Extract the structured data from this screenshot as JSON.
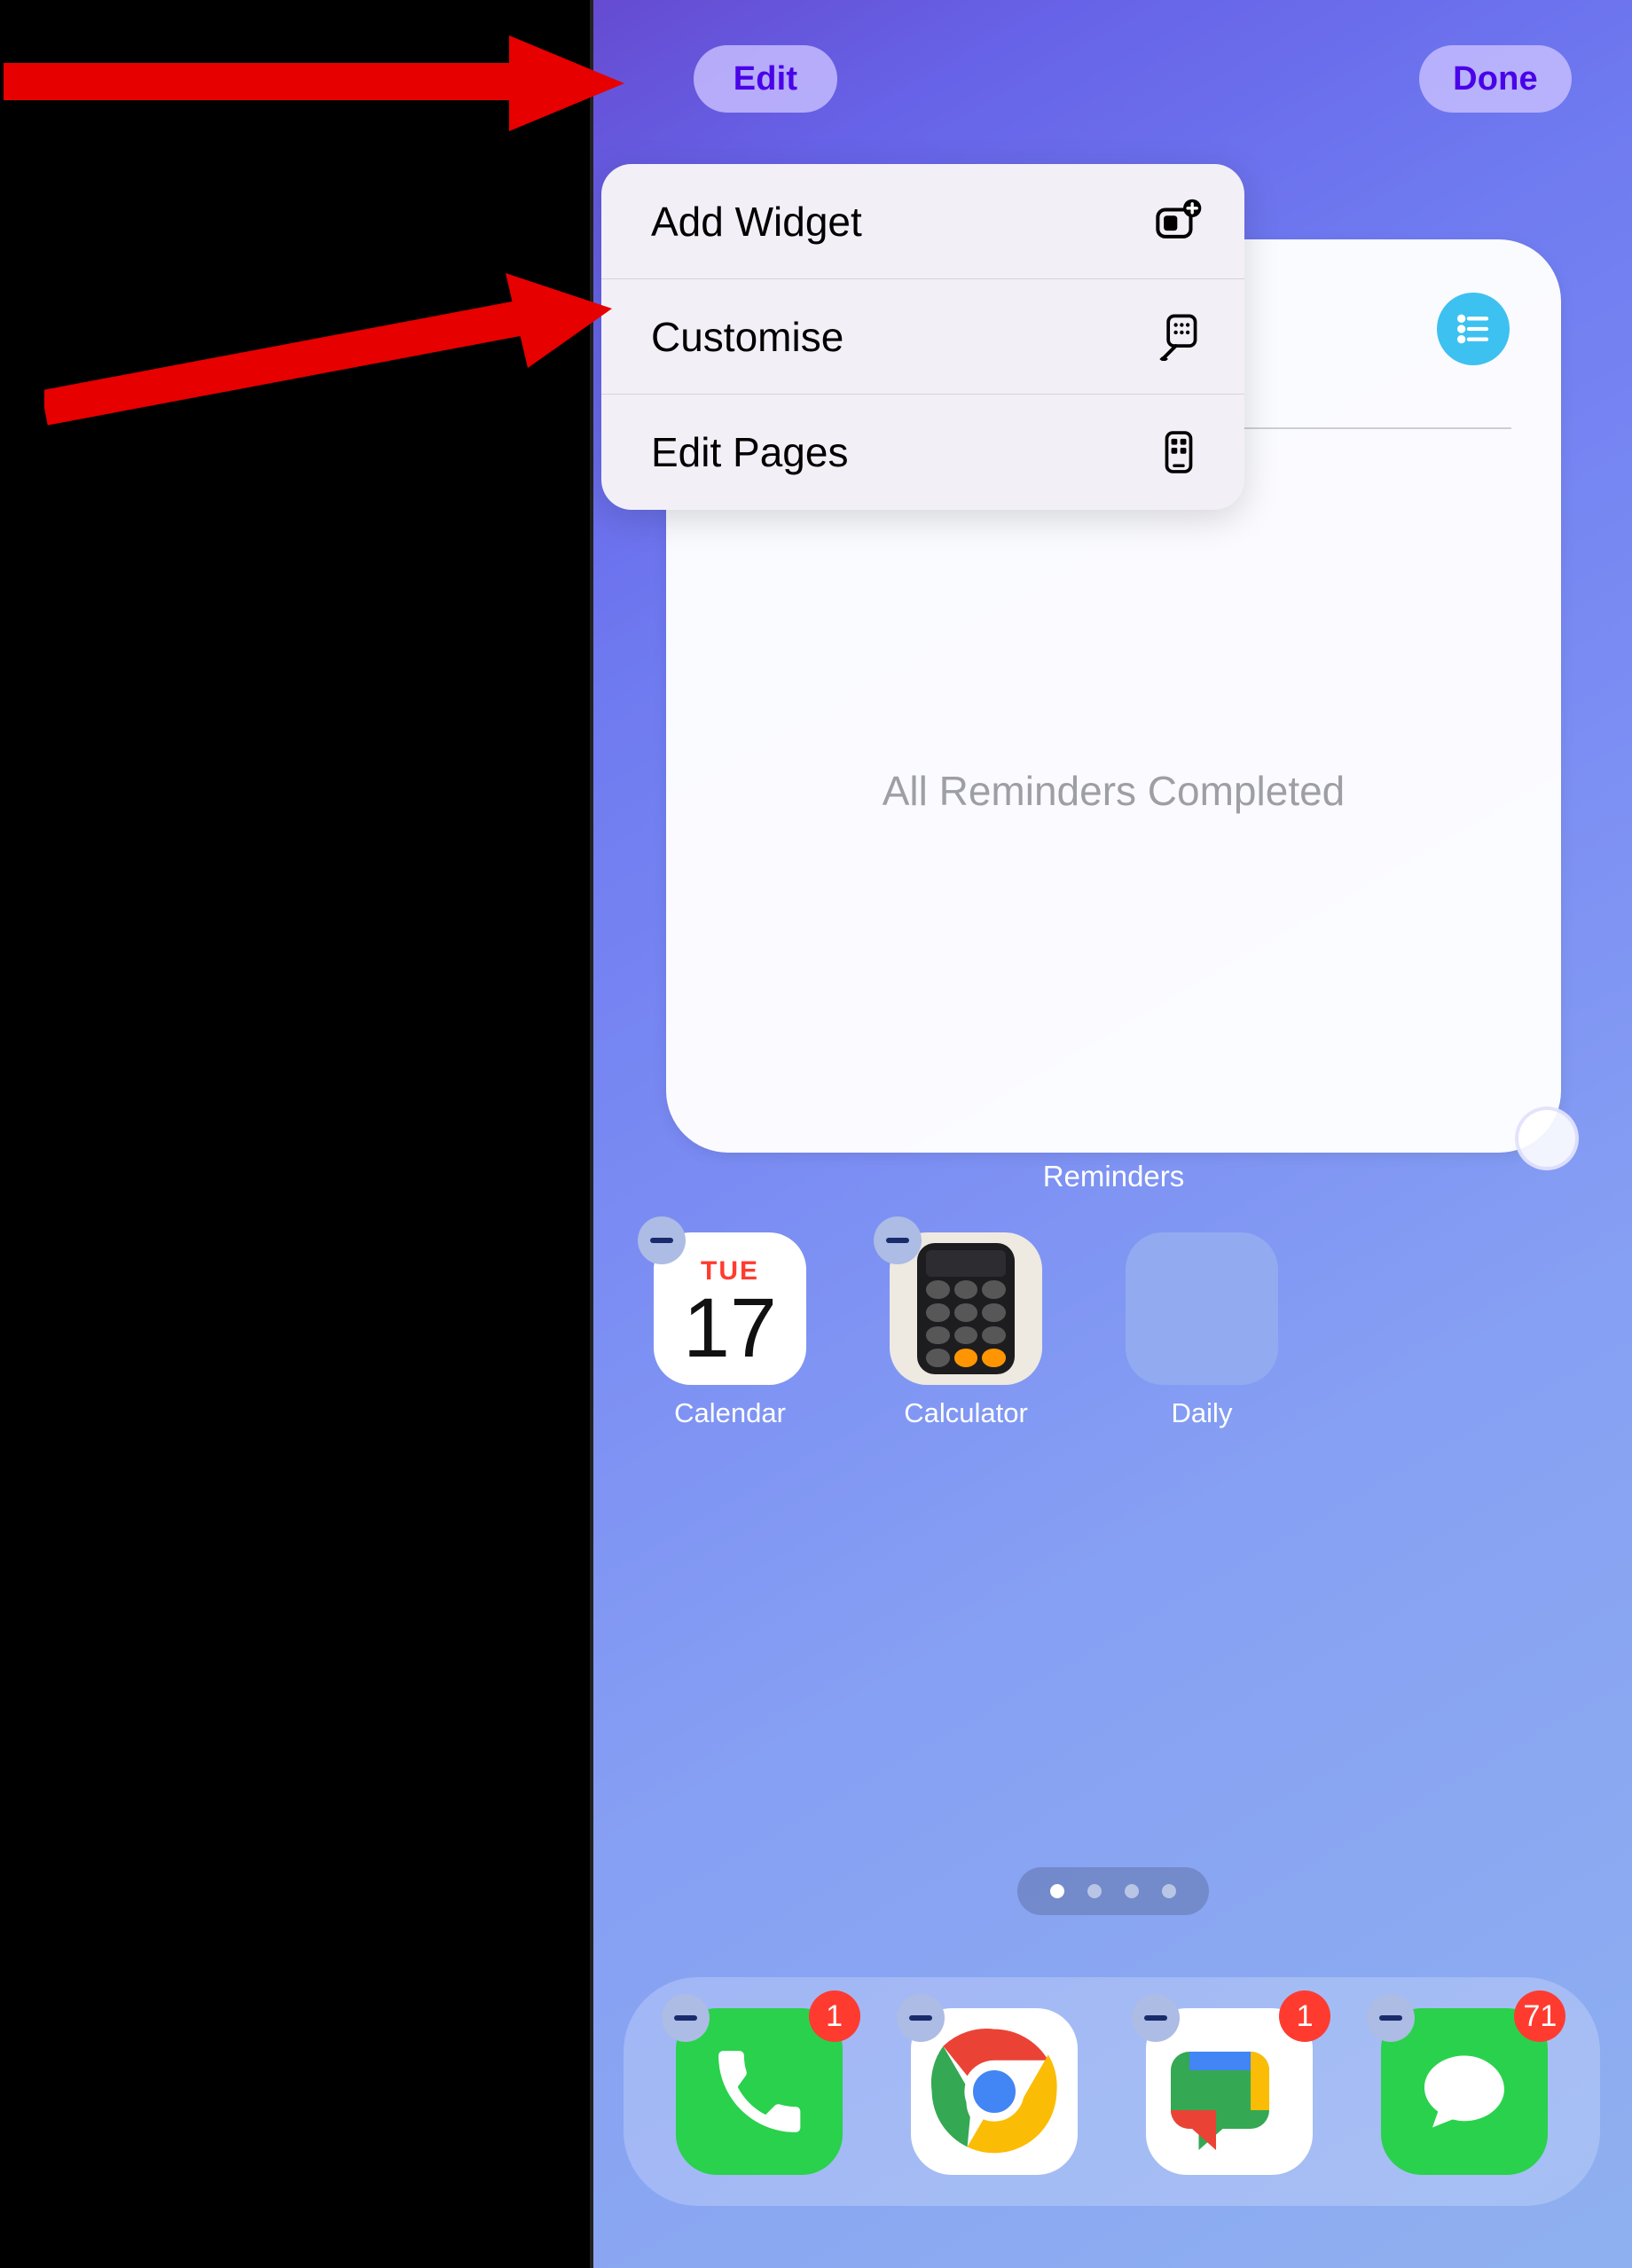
{
  "top_bar": {
    "edit_label": "Edit",
    "done_label": "Done"
  },
  "edit_menu": {
    "items": [
      {
        "label": "Add Widget",
        "icon": "add-widget-icon"
      },
      {
        "label": "Customise",
        "icon": "customise-icon"
      },
      {
        "label": "Edit Pages",
        "icon": "edit-pages-icon"
      }
    ]
  },
  "reminders_widget": {
    "body_text": "All Reminders Completed",
    "label": "Reminders"
  },
  "home_apps": [
    {
      "name": "Calendar",
      "kind": "calendar",
      "removable": true,
      "day_abbrev": "TUE",
      "day_number": "17"
    },
    {
      "name": "Calculator",
      "kind": "calculator",
      "removable": true
    },
    {
      "name": "Daily",
      "kind": "daily",
      "removable": false
    }
  ],
  "page_dots": {
    "count": 4,
    "active_index": 0
  },
  "dock": [
    {
      "name": "Phone",
      "kind": "phone",
      "badge": "1"
    },
    {
      "name": "Chrome",
      "kind": "chrome",
      "badge": null
    },
    {
      "name": "Google Chat",
      "kind": "googlechat",
      "badge": "1"
    },
    {
      "name": "Messages",
      "kind": "messages",
      "badge": "71"
    }
  ]
}
